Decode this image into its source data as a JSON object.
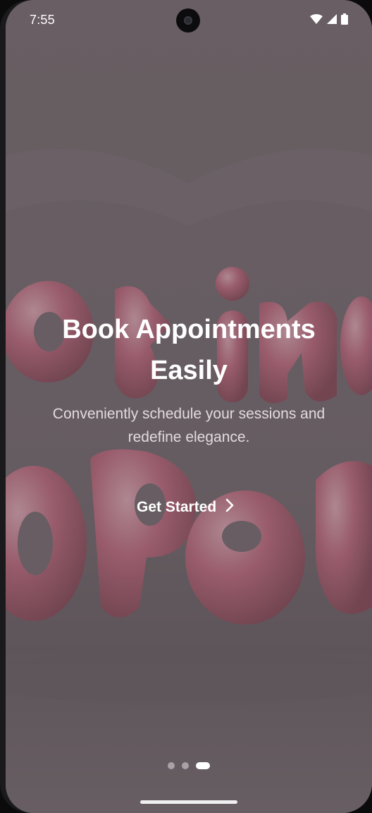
{
  "status_bar": {
    "time": "7:55",
    "icons": [
      "wifi-icon",
      "cellular-signal-icon",
      "battery-icon"
    ]
  },
  "onboarding": {
    "title": "Book Appointments Easily",
    "subtitle": "Conveniently schedule your sessions and redefine elegance.",
    "cta_label": "Get Started",
    "cta_icon": "chevron-right-icon",
    "page_count": 3,
    "current_page": 3
  },
  "colors": {
    "background": "#6a5d62",
    "balloon_letters": "#b8566f",
    "text": "#ffffff",
    "subtitle_text": "#e3dadd",
    "dot_inactive": "#a9a1a5",
    "dot_active": "#ffffff"
  }
}
